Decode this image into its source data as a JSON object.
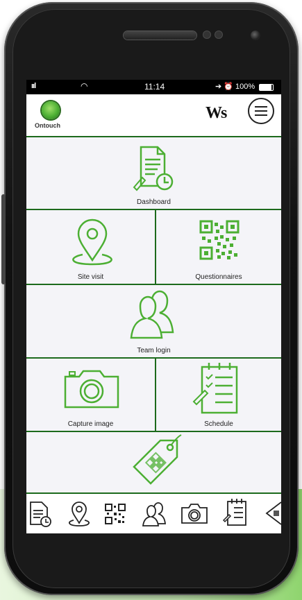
{
  "status_bar": {
    "signal": "ııl",
    "wifi": "◠",
    "time": "11:14",
    "right": "➔ ⏰ 100%"
  },
  "app": {
    "logo_text": "Ontouch",
    "brand_mark": "Ws"
  },
  "tiles": [
    {
      "label": "Dashboard",
      "icon": "document-clock-icon"
    },
    {
      "label": "Site visit",
      "icon": "map-pin-icon"
    },
    {
      "label": "Questionnaires",
      "icon": "qr-code-icon"
    },
    {
      "label": "Team login",
      "icon": "team-users-icon"
    },
    {
      "label": "Capture image",
      "icon": "camera-icon"
    },
    {
      "label": "Schedule",
      "icon": "checklist-icon"
    },
    {
      "label": "",
      "icon": "qr-tag-icon"
    }
  ],
  "bottom_nav": [
    "document-clock-icon",
    "map-pin-icon",
    "qr-code-icon",
    "team-users-icon",
    "camera-icon",
    "checklist-icon",
    "qr-tag-icon"
  ],
  "colors": {
    "accent": "#4caf33",
    "border": "#1c6a1c",
    "tile_bg": "#f4f4f8"
  }
}
